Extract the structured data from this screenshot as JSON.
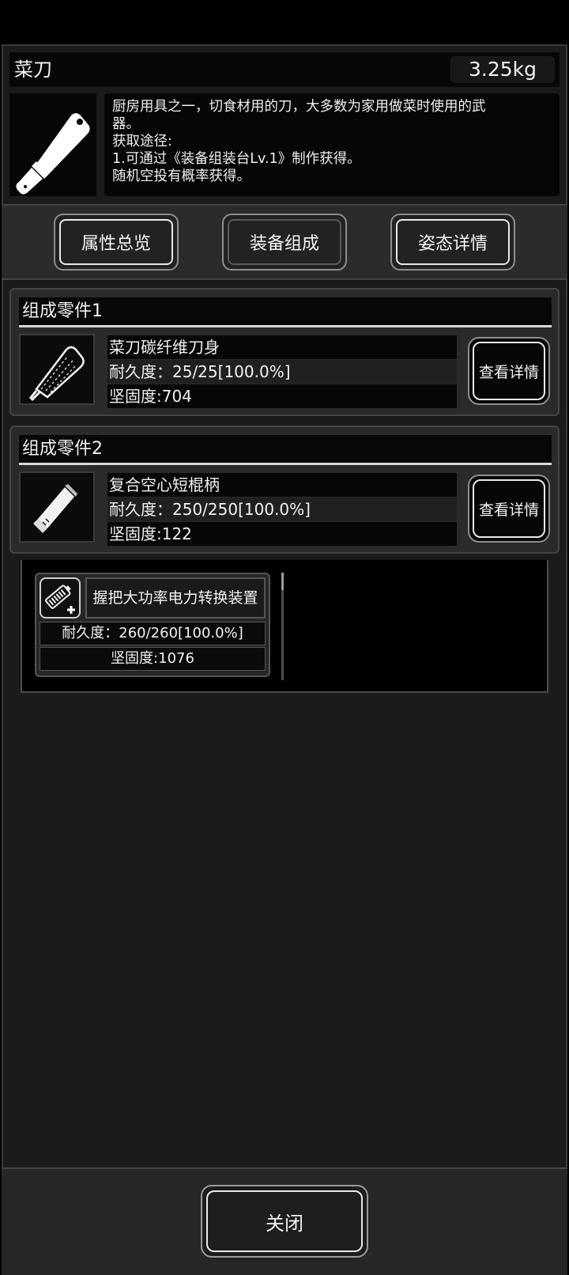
{
  "item": {
    "name": "菜刀",
    "weight": "3.25kg",
    "icon": "cleaver-icon",
    "description": [
      "厨房用具之一，切食材用的刀，大多数为家用做菜时使用的武",
      "器。",
      "获取途径:",
      "1.可通过《装备组装台Lv.1》制作获得。",
      "随机空投有概率获得。"
    ]
  },
  "tabs": [
    {
      "label": "属性总览",
      "active": false
    },
    {
      "label": "装备组成",
      "active": true
    },
    {
      "label": "姿态详情",
      "active": false
    }
  ],
  "components": [
    {
      "header": "组成零件1",
      "name": "菜刀碳纤维刀身",
      "durability": "耐久度：25/25[100.0%]",
      "hardness": "坚固度:704",
      "detail_label": "查看详情",
      "icon": "blade-icon"
    },
    {
      "header": "组成零件2",
      "name": "复合空心短棍柄",
      "durability": "耐久度：250/250[100.0%]",
      "hardness": "坚固度:122",
      "detail_label": "查看详情",
      "icon": "handle-icon"
    }
  ],
  "module": {
    "name": "握把大功率电力转换装置",
    "durability": "耐久度：260/260[100.0%]",
    "hardness": "坚固度:1076",
    "icon": "battery-plus-icon"
  },
  "footer": {
    "close_label": "关闭"
  },
  "colors": {
    "background": "#000000",
    "panel": "#1b1b1b",
    "button_border": "#e8e8e8"
  }
}
